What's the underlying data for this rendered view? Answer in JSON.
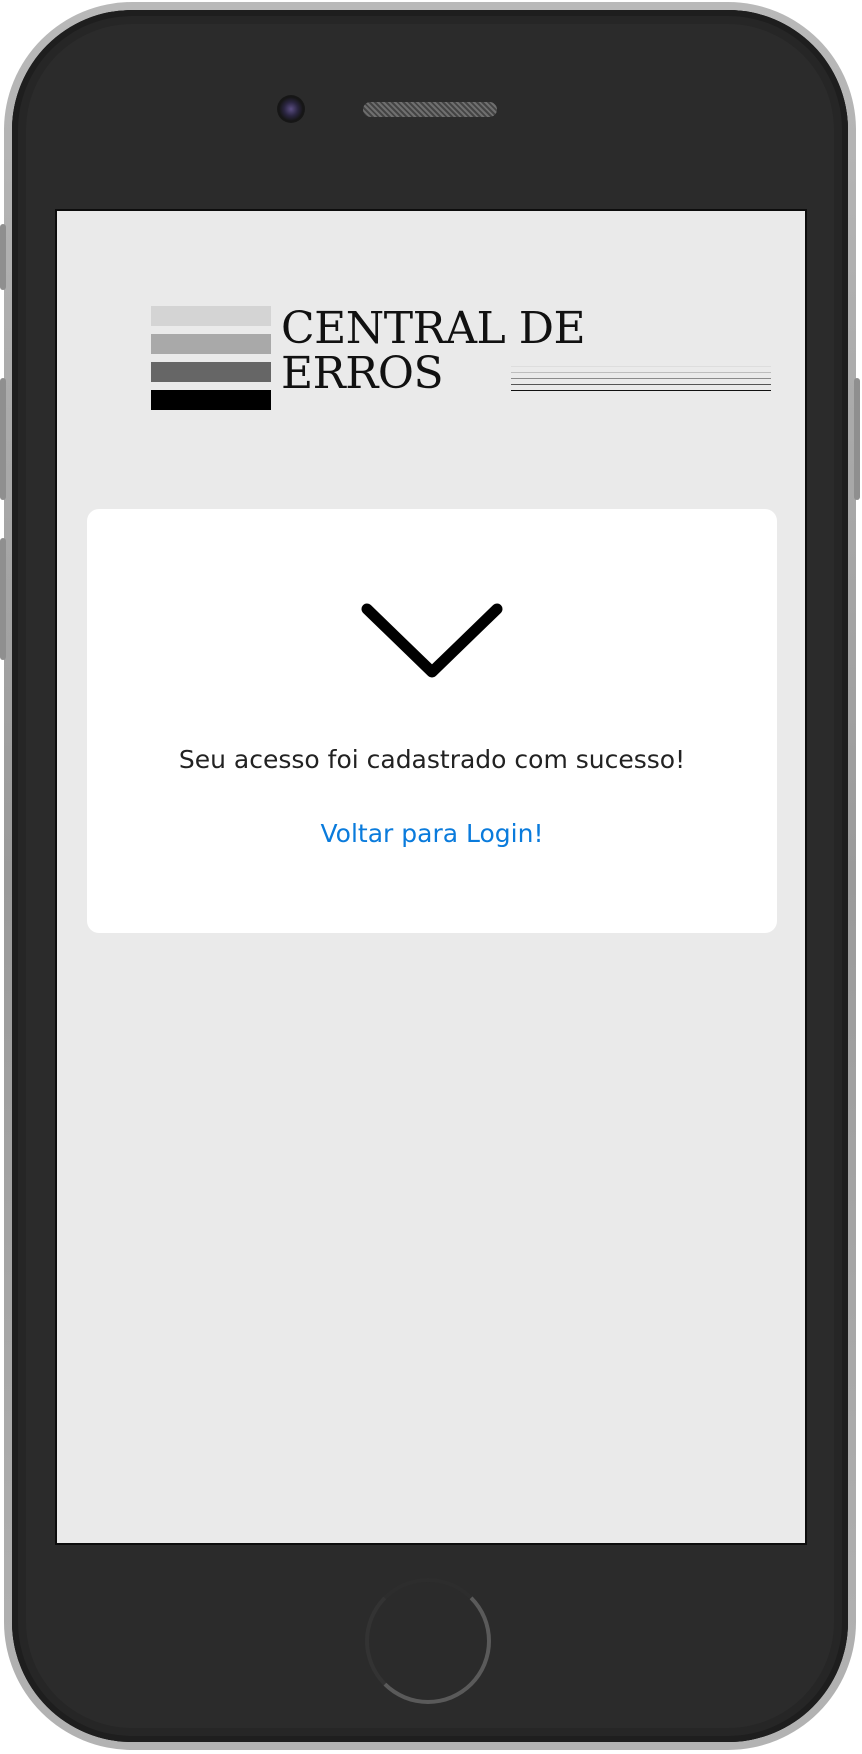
{
  "logo": {
    "line1": "CENTRAL DE",
    "line2": "ERROS",
    "bar_colors": [
      "#d4d4d4",
      "#a9a9a9",
      "#666666",
      "#000000"
    ]
  },
  "success": {
    "icon": "check-icon",
    "message": "Seu acesso foi cadastrado com sucesso!",
    "link_label": "Voltar para Login!"
  },
  "colors": {
    "screen_bg": "#eaeaea",
    "card_bg": "#ffffff",
    "link": "#0a7bdc",
    "frame": "#2b2b2b"
  }
}
